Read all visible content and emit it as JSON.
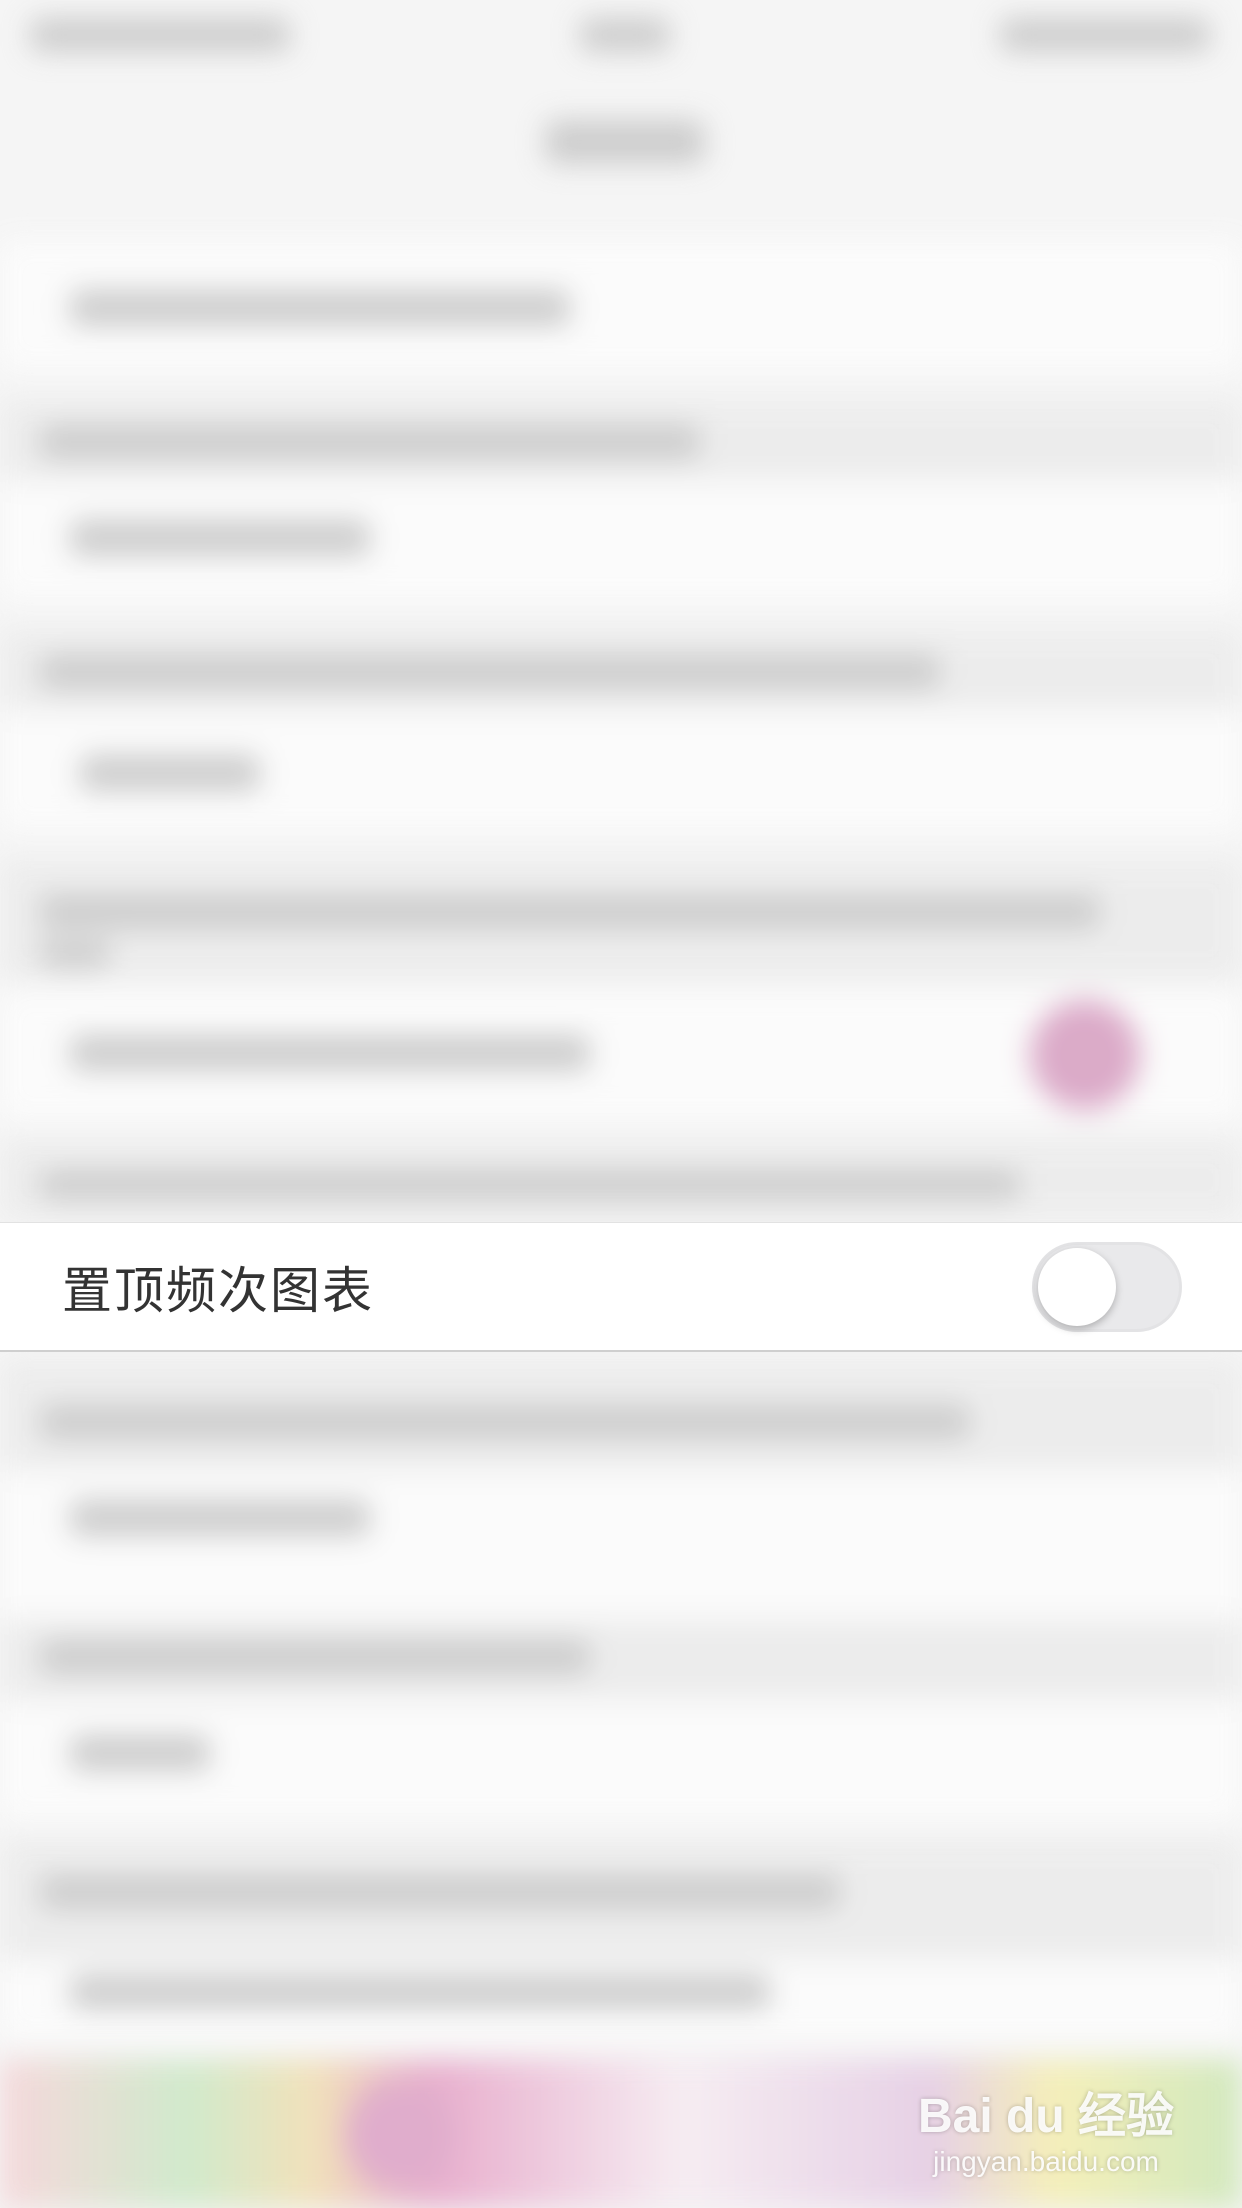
{
  "pinned_setting": {
    "label": "置顶频次图表",
    "toggle_on": false
  },
  "watermark": {
    "brand": "Bai du 经验",
    "url": "jingyan.baidu.com"
  },
  "colors": {
    "toggle_off_track": "#e9e9eb",
    "knob": "#ffffff",
    "pink_accent": "#d9a3c4"
  }
}
